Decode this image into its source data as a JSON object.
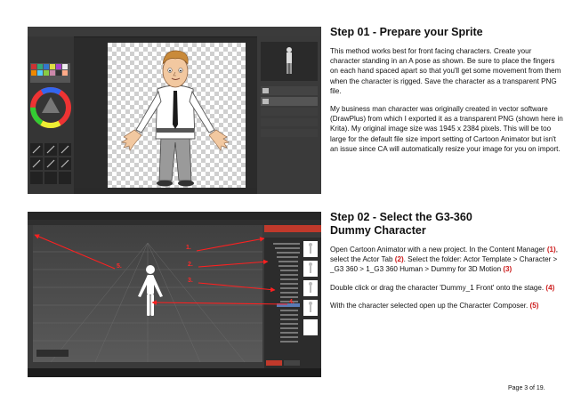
{
  "step1": {
    "title": "Step 01 - Prepare your Sprite",
    "para1": "This method works best for front facing characters. Create your character standing in an A pose as shown. Be sure to place the fingers on each hand spaced apart so that you'll get some movement from them when the character is rigged. Save the character as a transparent PNG file.",
    "para2": "My business man character was originally created in vector software (DrawPlus) from which I exported it as a transparent PNG (shown here in Krita). My original image size was 1945 x 2384 pixels. This will be too large for the default file size import setting of Cartoon Animator but isn't an issue since CA will automatically resize your image for you on import."
  },
  "step2": {
    "title_line1": "Step 02 - Select the G3-360",
    "title_line2": "Dummy Character",
    "p1_a": "Open Cartoon Animator with a new project. In the Content Manager ",
    "p1_n1": "(1)",
    "p1_b": ", select the Actor Tab ",
    "p1_n2": "(2)",
    "p1_c": ". Select the folder: Actor Template > Character > _G3 360 > 1_G3 360 Human > Dummy for 3D Motion ",
    "p1_n3": "(3)",
    "p2_a": "Double click or drag the character 'Dummy_1 Front' onto the stage. ",
    "p2_n4": "(4)",
    "p3_a": "With the character selected open up the Character Composer. ",
    "p3_n5": "(5)"
  },
  "screenshot2_labels": [
    "1.",
    "2.",
    "3.",
    "4.",
    "5."
  ],
  "page_number": "Page 3 of 19."
}
